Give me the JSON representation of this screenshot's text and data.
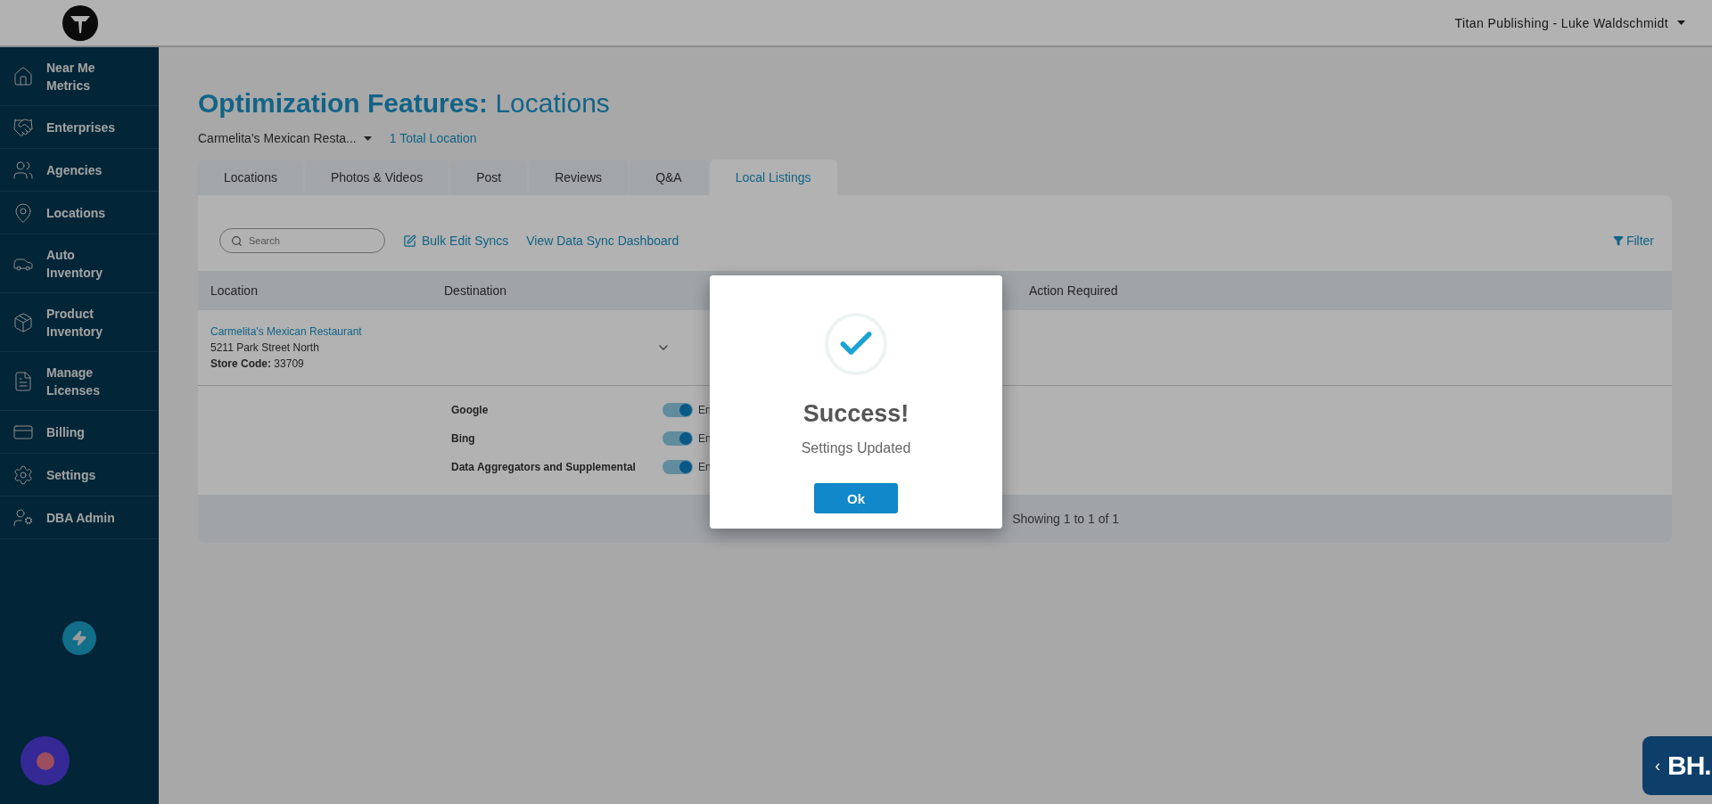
{
  "header": {
    "account": "Titan Publishing - Luke Waldschmidt"
  },
  "sidebar": {
    "items": [
      {
        "label": "Near Me Metrics",
        "kind": "home"
      },
      {
        "label": "Enterprises",
        "kind": "handshake"
      },
      {
        "label": "Agencies",
        "kind": "people"
      },
      {
        "label": "Locations",
        "kind": "pin"
      },
      {
        "label": "Auto Inventory",
        "kind": "car"
      },
      {
        "label": "Product Inventory",
        "kind": "box"
      },
      {
        "label": "Manage Licenses",
        "kind": "license"
      },
      {
        "label": "Billing",
        "kind": "card"
      },
      {
        "label": "Settings",
        "kind": "gear"
      },
      {
        "label": "DBA Admin",
        "kind": "admin"
      }
    ]
  },
  "page": {
    "title_bold": "Optimization Features:",
    "title_rest": "Locations",
    "location_select": "Carmelita's Mexican Resta...",
    "location_count": "1 Total Location"
  },
  "tabs": [
    {
      "label": "Locations",
      "selected": false
    },
    {
      "label": "Photos & Videos",
      "selected": false
    },
    {
      "label": "Post",
      "selected": false
    },
    {
      "label": "Reviews",
      "selected": false
    },
    {
      "label": "Q&A",
      "selected": false
    },
    {
      "label": "Local Listings",
      "selected": true
    }
  ],
  "toolbar": {
    "search_placeholder": "Search",
    "bulk_edit": "Bulk Edit Syncs",
    "dashboard_link": "View Data Sync Dashboard",
    "filter": "Filter"
  },
  "table": {
    "columns": [
      "Location",
      "Destination",
      "Action Required"
    ],
    "rows": [
      {
        "name": "Carmelita's Mexican Restaurant",
        "address": "5211 Park Street North",
        "store_code_label": "Store Code:",
        "store_code": "33709",
        "expanded": true
      }
    ]
  },
  "destinations": [
    {
      "name": "Google",
      "on": true,
      "status": "En"
    },
    {
      "name": "Bing",
      "on": true,
      "status": "En"
    },
    {
      "name": "Data Aggregators and Supplemental",
      "on": true,
      "status": "En"
    }
  ],
  "footer": {
    "showing": "Showing 1 to 1 of 1"
  },
  "dialog": {
    "title": "Success!",
    "message": "Settings Updated",
    "button": "Ok"
  },
  "widget": {
    "arrow": "‹",
    "label": "BH."
  }
}
